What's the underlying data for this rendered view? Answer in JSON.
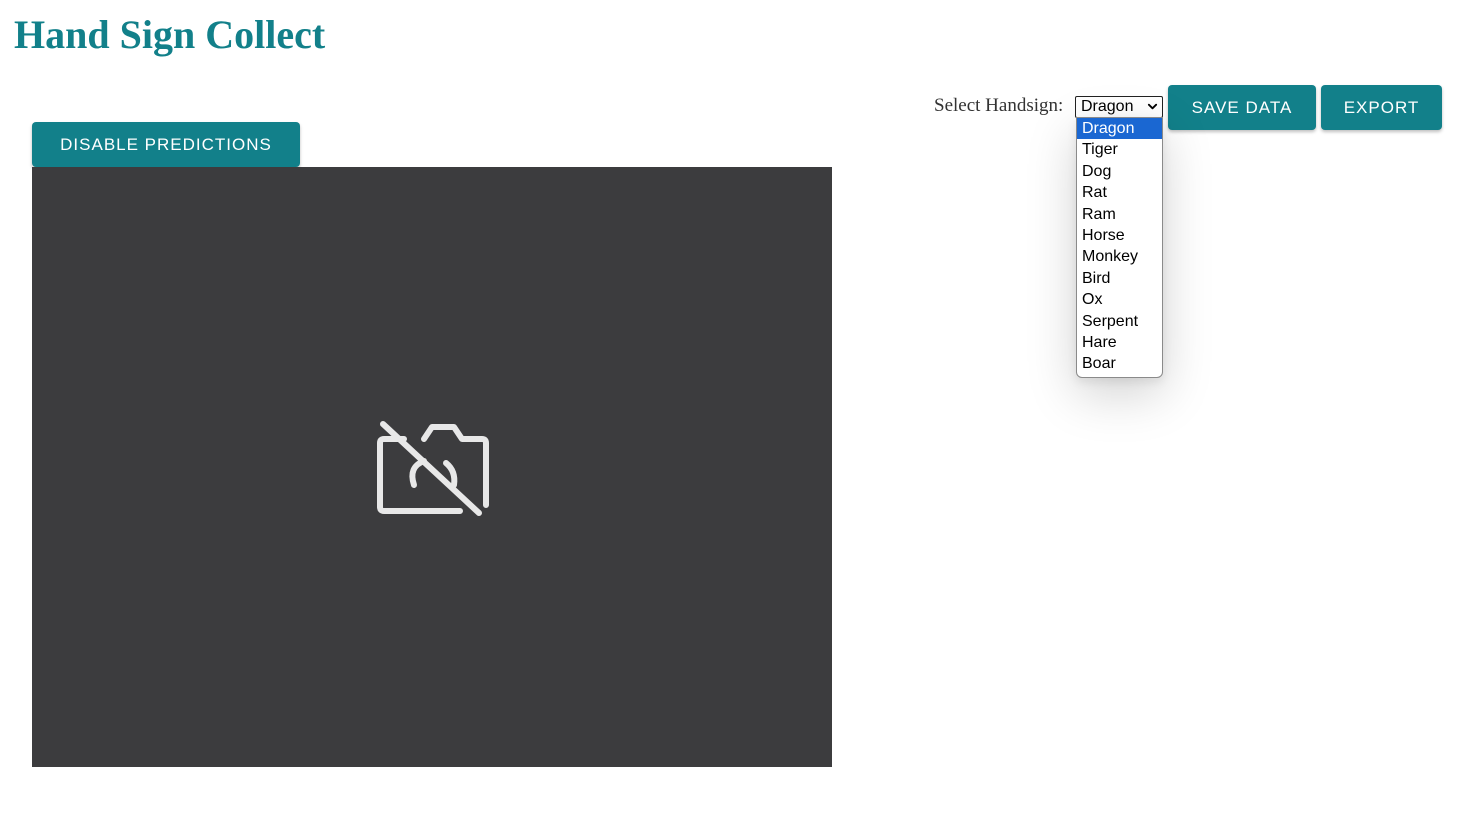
{
  "header": {
    "title": "Hand Sign Collect"
  },
  "toolbar": {
    "select_label": "Select Handsign:",
    "selected_value": "Dragon",
    "save_label": "SAVE DATA",
    "export_label": "EXPORT"
  },
  "dropdown": {
    "options": [
      "Dragon",
      "Tiger",
      "Dog",
      "Rat",
      "Ram",
      "Horse",
      "Monkey",
      "Bird",
      "Ox",
      "Serpent",
      "Hare",
      "Boar"
    ],
    "highlighted": "Dragon"
  },
  "controls": {
    "disable_predictions_label": "DISABLE PREDICTIONS"
  },
  "video": {
    "state_icon": "camera-off-icon"
  },
  "colors": {
    "accent": "#12808a",
    "video_bg": "#3c3c3e",
    "option_highlight": "#1a67d2"
  }
}
